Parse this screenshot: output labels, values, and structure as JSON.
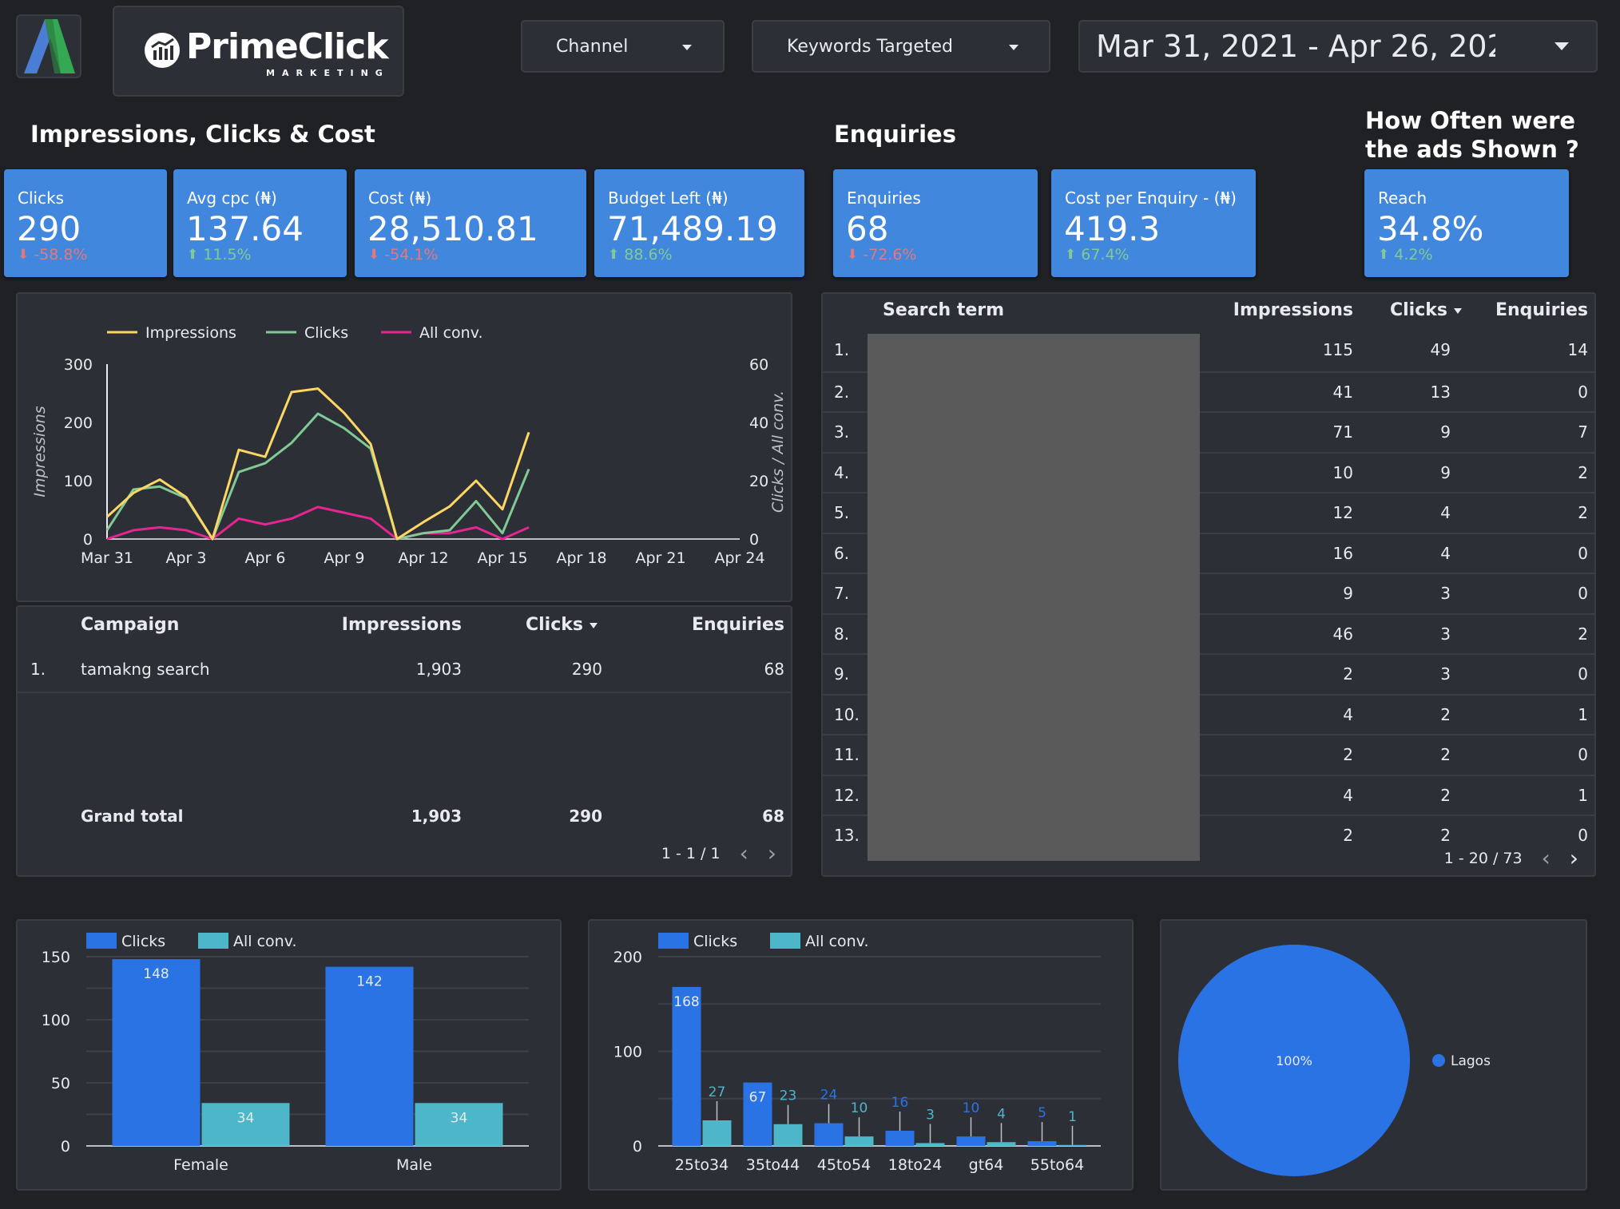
{
  "header": {
    "brand_name": "PrimeClick",
    "brand_tagline": "MARKETING",
    "filters": [
      {
        "label": "Channel",
        "icon": "chevron-down-icon"
      },
      {
        "label": "Keywords Targeted",
        "icon": "chevron-down-icon"
      }
    ],
    "date_range": "Mar 31, 2021 - Apr 26, 202"
  },
  "sections": {
    "impressions_title": "Impressions, Clicks & Cost",
    "enquiries_title": "Enquiries",
    "reach_title_line1": "How Often were",
    "reach_title_line2": "the ads Shown ?"
  },
  "kpis": [
    {
      "label": "Clicks",
      "value": "290",
      "delta": "-58.8%",
      "direction": "down"
    },
    {
      "label": "Avg cpc (₦)",
      "value": "137.64",
      "delta": "11.5%",
      "direction": "up"
    },
    {
      "label": "Cost (₦)",
      "value": "28,510.81",
      "delta": "-54.1%",
      "direction": "down"
    },
    {
      "label": "Budget Left (₦)",
      "value": "71,489.19",
      "delta": "88.6%",
      "direction": "up"
    },
    {
      "label": "Enquiries",
      "value": "68",
      "delta": "-72.6%",
      "direction": "down"
    },
    {
      "label": "Cost per Enquiry - (₦)",
      "value": "419.3",
      "delta": "67.4%",
      "direction": "up"
    },
    {
      "label": "Reach",
      "value": "34.8%",
      "delta": "4.2%",
      "direction": "up"
    }
  ],
  "colors": {
    "kpi_bg": "#4187dd",
    "delta_down": "#e5787a",
    "delta_up": "#81c995",
    "impressions": "#fdd663",
    "clicks": "#81c995",
    "all_conv": "#e52592",
    "bar_clicks": "#2a73e5",
    "bar_conv": "#4db6c9"
  },
  "campaign_table": {
    "columns": [
      "Campaign",
      "Impressions",
      "Clicks",
      "Enquiries"
    ],
    "sorted_column": "Clicks",
    "rows": [
      {
        "index": "1.",
        "campaign": "tamakng search",
        "impressions": "1,903",
        "clicks": "290",
        "enquiries": "68"
      }
    ],
    "total": {
      "label": "Grand total",
      "impressions": "1,903",
      "clicks": "290",
      "enquiries": "68"
    },
    "pagination": "1 - 1 / 1"
  },
  "search_term_table": {
    "columns": [
      "Search term",
      "Impressions",
      "Clicks",
      "Enquiries"
    ],
    "sorted_column": "Clicks",
    "rows": [
      {
        "index": "1.",
        "impressions": "115",
        "clicks": "49",
        "enquiries": "14"
      },
      {
        "index": "2.",
        "impressions": "41",
        "clicks": "13",
        "enquiries": "0"
      },
      {
        "index": "3.",
        "impressions": "71",
        "clicks": "9",
        "enquiries": "7"
      },
      {
        "index": "4.",
        "impressions": "10",
        "clicks": "9",
        "enquiries": "2"
      },
      {
        "index": "5.",
        "impressions": "12",
        "clicks": "4",
        "enquiries": "2"
      },
      {
        "index": "6.",
        "impressions": "16",
        "clicks": "4",
        "enquiries": "0"
      },
      {
        "index": "7.",
        "impressions": "9",
        "clicks": "3",
        "enquiries": "0"
      },
      {
        "index": "8.",
        "impressions": "46",
        "clicks": "3",
        "enquiries": "2"
      },
      {
        "index": "9.",
        "impressions": "2",
        "clicks": "3",
        "enquiries": "0"
      },
      {
        "index": "10.",
        "impressions": "4",
        "clicks": "2",
        "enquiries": "1"
      },
      {
        "index": "11.",
        "impressions": "2",
        "clicks": "2",
        "enquiries": "0"
      },
      {
        "index": "12.",
        "impressions": "4",
        "clicks": "2",
        "enquiries": "1"
      },
      {
        "index": "13.",
        "impressions": "2",
        "clicks": "2",
        "enquiries": "0"
      }
    ],
    "pagination": "1 - 20 / 73"
  },
  "chart_data": [
    {
      "type": "line",
      "title": "",
      "legend": [
        "Impressions",
        "Clicks",
        "All conv."
      ],
      "legend_position": "top-left",
      "x": [
        "Mar 31",
        "Apr 1",
        "Apr 2",
        "Apr 3",
        "Apr 4",
        "Apr 5",
        "Apr 6",
        "Apr 7",
        "Apr 8",
        "Apr 9",
        "Apr 10",
        "Apr 11",
        "Apr 12",
        "Apr 13",
        "Apr 14",
        "Apr 15",
        "Apr 16"
      ],
      "x_ticks": [
        "Mar 31",
        "Apr 3",
        "Apr 6",
        "Apr 9",
        "Apr 12",
        "Apr 15",
        "Apr 18",
        "Apr 21",
        "Apr 24"
      ],
      "x_range_days": 24,
      "ylabel": "Impressions",
      "ylabel_right": "Clicks / All conv.",
      "ylim": [
        0,
        300
      ],
      "ylim_right": [
        0,
        60
      ],
      "y_ticks": [
        0,
        100,
        200,
        300
      ],
      "y_ticks_right": [
        0,
        20,
        40,
        60
      ],
      "series": [
        {
          "name": "Impressions",
          "axis": "left",
          "values": [
            38,
            79,
            102,
            72,
            0,
            153,
            141,
            252,
            258,
            216,
            163,
            0,
            29,
            56,
            100,
            51,
            183
          ]
        },
        {
          "name": "Clicks",
          "axis": "right",
          "values": [
            3,
            17,
            18,
            14,
            0,
            23,
            26,
            33,
            43,
            38,
            31,
            0,
            2,
            3,
            13,
            2,
            24
          ]
        },
        {
          "name": "All conv.",
          "axis": "right",
          "values": [
            0,
            3,
            4,
            3,
            0,
            7,
            5,
            7,
            11,
            9,
            7,
            0,
            2,
            2,
            4,
            0,
            4
          ]
        }
      ]
    },
    {
      "type": "bar",
      "title": "",
      "legend_position": "top-left",
      "categories": [
        "Female",
        "Male"
      ],
      "ylim": [
        0,
        150
      ],
      "y_ticks": [
        0,
        50,
        100,
        150
      ],
      "series": [
        {
          "name": "Clicks",
          "values": [
            148,
            142
          ]
        },
        {
          "name": "All conv.",
          "values": [
            34,
            34
          ]
        }
      ]
    },
    {
      "type": "bar",
      "title": "",
      "legend_position": "top-left",
      "categories": [
        "25to34",
        "35to44",
        "45to54",
        "18to24",
        "gt64",
        "55to64"
      ],
      "ylim": [
        0,
        200
      ],
      "y_ticks": [
        0,
        100,
        200
      ],
      "series": [
        {
          "name": "Clicks",
          "values": [
            168,
            67,
            24,
            16,
            10,
            5
          ]
        },
        {
          "name": "All conv.",
          "values": [
            27,
            23,
            10,
            3,
            4,
            1
          ]
        }
      ]
    },
    {
      "type": "pie",
      "title": "",
      "legend_position": "right",
      "slices": [
        {
          "label": "Lagos",
          "value": 100,
          "display": "100%"
        }
      ]
    }
  ]
}
